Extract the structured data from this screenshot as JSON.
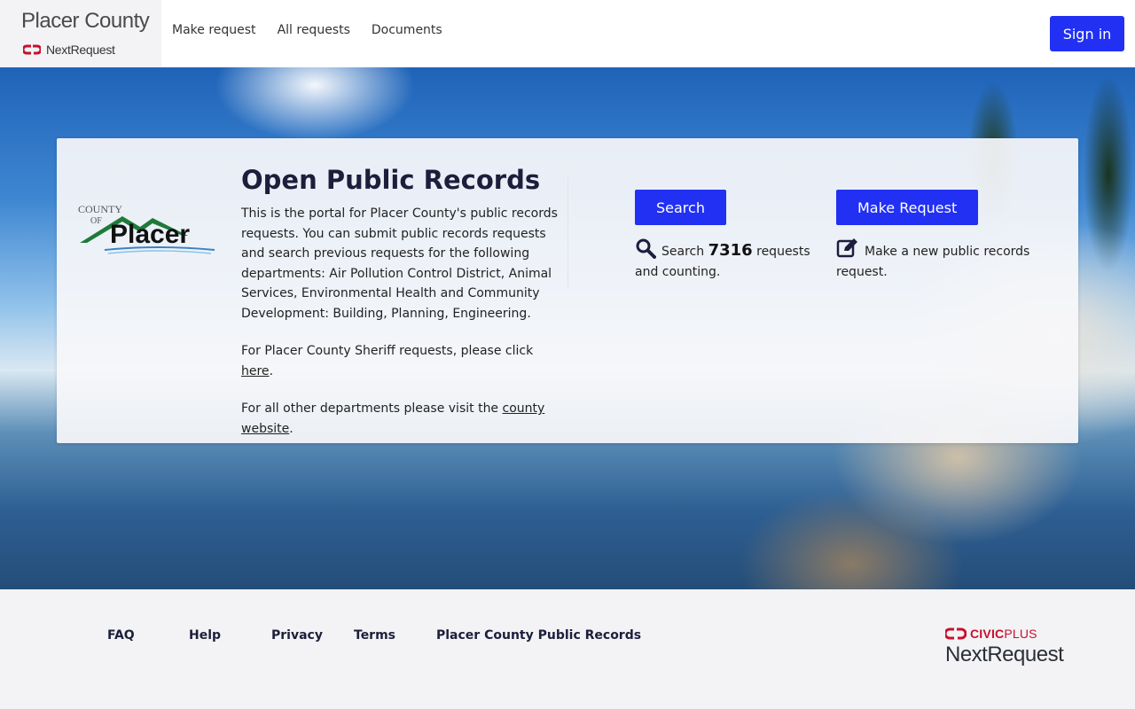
{
  "header": {
    "brand_title": "Placer County",
    "brand_sub": "NextRequest",
    "nav": [
      "Make request",
      "All requests",
      "Documents"
    ],
    "sign_in": "Sign in"
  },
  "card": {
    "logo": {
      "county": "COUNTY",
      "of": "OF",
      "name": "Placer"
    },
    "title": "Open Public Records",
    "intro": "This is the portal for Placer County's public records requests. You can submit public records requests and search previous requests for the following departments: Air Pollution Control District, Animal Services, Environmental Health and Community Development: Building, Planning, Engineering.",
    "sheriff_pre": "For Placer County Sheriff requests, please click ",
    "sheriff_link": "here",
    "sheriff_post": ".",
    "other_pre": "For all other departments please visit the ",
    "other_link": "county website",
    "other_post": ".",
    "search": {
      "button": "Search",
      "pre": "Search ",
      "count": "7316",
      "post": " requests and counting.",
      "icon": "search-icon"
    },
    "make": {
      "button": "Make Request",
      "text": "Make a new public records request.",
      "icon": "edit-icon"
    }
  },
  "footer": {
    "links": [
      "FAQ",
      "Help",
      "Privacy",
      "Terms",
      "Placer County Public Records"
    ],
    "civic_brand": "CIVIC",
    "civic_brand2": "PLUS",
    "product": "NextRequest"
  },
  "colors": {
    "accent": "#2130f3",
    "civic_red": "#c8102e",
    "footer_bg": "#f3f3f5"
  }
}
